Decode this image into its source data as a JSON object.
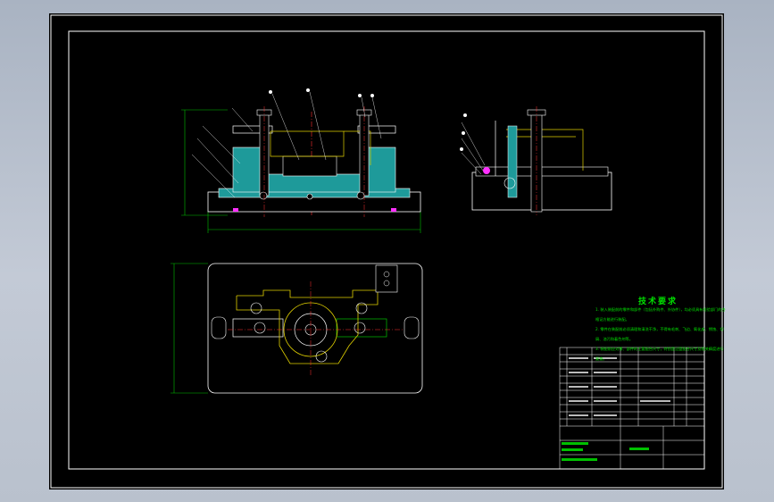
{
  "technical_requirements": {
    "title": "技术要求",
    "notes": [
      "1. 装入装配前的零件和部件（包括外购件、外协件），均必须具有检验部门的合",
      "   格证方能进行装配。",
      "2. 零件在装配前必须清理和清洗干净，不得有毛刺、飞边、氧化皮、锈蚀、切",
      "   屑、油污和着色剂等。",
      "3. 装配前应对零、部件的主要配合尺寸，特别是过盈配合尺寸及相关精度进行",
      "   复查。"
    ]
  },
  "colors": {
    "background": "#000000",
    "frame": "#ffffff",
    "outline": "#ffffff",
    "section_fill": "#1e9a9a",
    "hidden_part": "#e0d000",
    "center_line": "#ff3030",
    "dimension": "#00c000",
    "title_block": "#ffffff",
    "note_text": "#00e000"
  }
}
